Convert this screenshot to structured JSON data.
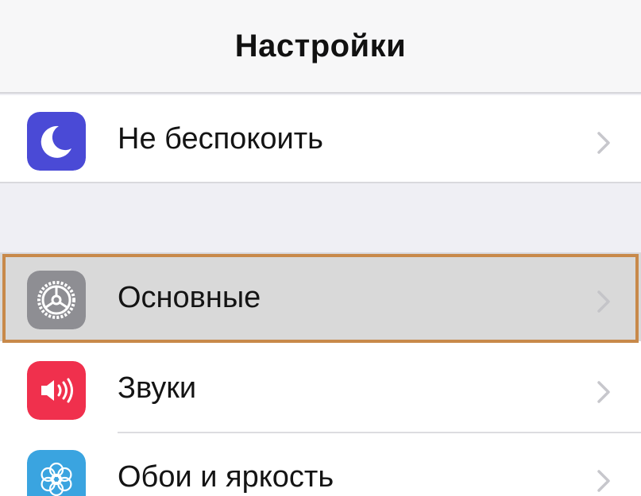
{
  "nav": {
    "title": "Настройки"
  },
  "rows": [
    {
      "label": "Не беспокоить",
      "icon": "moon-icon",
      "icon_color": "#4a4ad6"
    },
    {
      "label": "Основные",
      "icon": "gear-icon",
      "icon_color": "#8e8e93",
      "selected": true
    },
    {
      "label": "Звуки",
      "icon": "speaker-icon",
      "icon_color": "#f0304d"
    },
    {
      "label": "Обои и яркость",
      "icon": "flower-icon",
      "icon_color": "#3aa4e0"
    }
  ],
  "colors": {
    "background": "#efeff4",
    "highlight": "#d9d9d9",
    "selection_frame": "#c8894a",
    "chevron": "#c7c7cc"
  }
}
